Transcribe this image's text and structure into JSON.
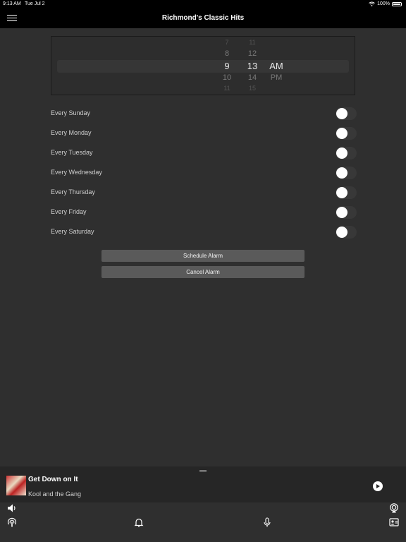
{
  "status": {
    "time": "9:13 AM",
    "date": "Tue Jul 2",
    "battery": "100%"
  },
  "nav": {
    "title": "Richmond's Classic Hits",
    "menu_icon": "hamburger-menu-icon"
  },
  "picker": {
    "hours": [
      "7",
      "8",
      "9",
      "10",
      "11"
    ],
    "minutes": [
      "11",
      "12",
      "13",
      "14",
      "15"
    ],
    "periods": [
      "",
      "",
      "AM",
      "PM",
      ""
    ],
    "selected": {
      "hour": "9",
      "minute": "13",
      "period": "AM"
    }
  },
  "days": [
    {
      "label": "Every Sunday",
      "on": false
    },
    {
      "label": "Every Monday",
      "on": false
    },
    {
      "label": "Every Tuesday",
      "on": false
    },
    {
      "label": "Every Wednesday",
      "on": false
    },
    {
      "label": "Every Thursday",
      "on": false
    },
    {
      "label": "Every Friday",
      "on": false
    },
    {
      "label": "Every Saturday",
      "on": false
    }
  ],
  "buttons": {
    "schedule": "Schedule Alarm",
    "cancel": "Cancel Alarm"
  },
  "now_playing": {
    "song": "Get Down on It",
    "artist": "Kool and the Gang"
  },
  "bottom_icons": [
    "volume-icon",
    "airplay-icon",
    "podcast-icon",
    "alarm-bell-icon",
    "microphone-icon",
    "contact-card-icon"
  ],
  "colors": {
    "background": "#2f2f2f",
    "bar": "#000000",
    "button": "#5a5a5a"
  }
}
